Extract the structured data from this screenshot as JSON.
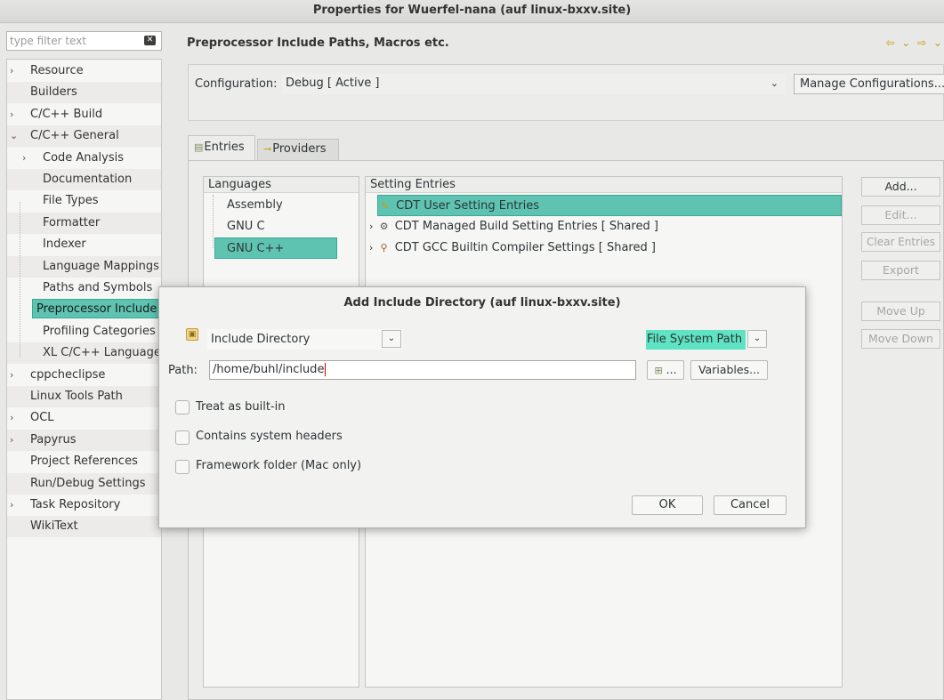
{
  "window": {
    "title": "Properties for Wuerfel-nana  (auf linux-bxxv.site)"
  },
  "left": {
    "filter_placeholder": "type filter text",
    "tree": [
      {
        "label": "Resource",
        "expander": "›"
      },
      {
        "label": "Builders",
        "expander": ""
      },
      {
        "label": "C/C++ Build",
        "expander": "›"
      },
      {
        "label": "C/C++ General",
        "expander": "⌄"
      },
      {
        "label": "Code Analysis",
        "expander": "›"
      },
      {
        "label": "Documentation",
        "expander": ""
      },
      {
        "label": "File Types",
        "expander": ""
      },
      {
        "label": "Formatter",
        "expander": ""
      },
      {
        "label": "Indexer",
        "expander": ""
      },
      {
        "label": "Language Mappings",
        "expander": ""
      },
      {
        "label": "Paths and Symbols",
        "expander": ""
      },
      {
        "label": "Preprocessor Include Paths, Macros etc.",
        "expander": ""
      },
      {
        "label": "Profiling Categories",
        "expander": ""
      },
      {
        "label": "XL C/C++ Language",
        "expander": ""
      },
      {
        "label": "cppcheclipse",
        "expander": "›"
      },
      {
        "label": "Linux Tools Path",
        "expander": ""
      },
      {
        "label": "OCL",
        "expander": "›"
      },
      {
        "label": "Papyrus",
        "expander": "›"
      },
      {
        "label": "Project References",
        "expander": ""
      },
      {
        "label": "Run/Debug Settings",
        "expander": ""
      },
      {
        "label": "Task Repository",
        "expander": "›"
      },
      {
        "label": "WikiText",
        "expander": ""
      }
    ]
  },
  "main": {
    "title": "Preprocessor Include Paths, Macros etc.",
    "nav_arrows": "⇦ ⌄ ⇨ ⌄",
    "configuration_label": "Configuration:",
    "configuration_value": "Debug  [ Active ]",
    "manage_button": "Manage Configurations...",
    "tabs": [
      "Entries",
      "Providers"
    ],
    "languages_header": "Languages",
    "languages": [
      "Assembly",
      "GNU C",
      "GNU C++"
    ],
    "setting_header": "Setting Entries",
    "settings": [
      {
        "label": "CDT User Setting Entries",
        "expander": ""
      },
      {
        "label": "CDT Managed Build Setting Entries   [ Shared ]",
        "expander": "›"
      },
      {
        "label": "CDT GCC Builtin Compiler Settings   [ Shared ]",
        "expander": "›"
      }
    ],
    "side_buttons": {
      "add": "Add...",
      "edit": "Edit...",
      "clear": "Clear Entries",
      "export": "Export",
      "move_up": "Move Up",
      "move_down": "Move Down"
    }
  },
  "dialog": {
    "title": "Add Include Directory  (auf linux-bxxv.site)",
    "kind_value": "Include Directory",
    "location_value": "File System Path",
    "path_label": "Path:",
    "path_value": "/home/buhl/include",
    "browse_label": "...",
    "variables_button": "Variables...",
    "checkboxes": [
      {
        "label": "Treat as built-in",
        "checked": false
      },
      {
        "label": "Contains system headers",
        "checked": false
      },
      {
        "label": "Framework folder (Mac only)",
        "checked": false
      }
    ],
    "ok_button": "OK",
    "cancel_button": "Cancel"
  }
}
